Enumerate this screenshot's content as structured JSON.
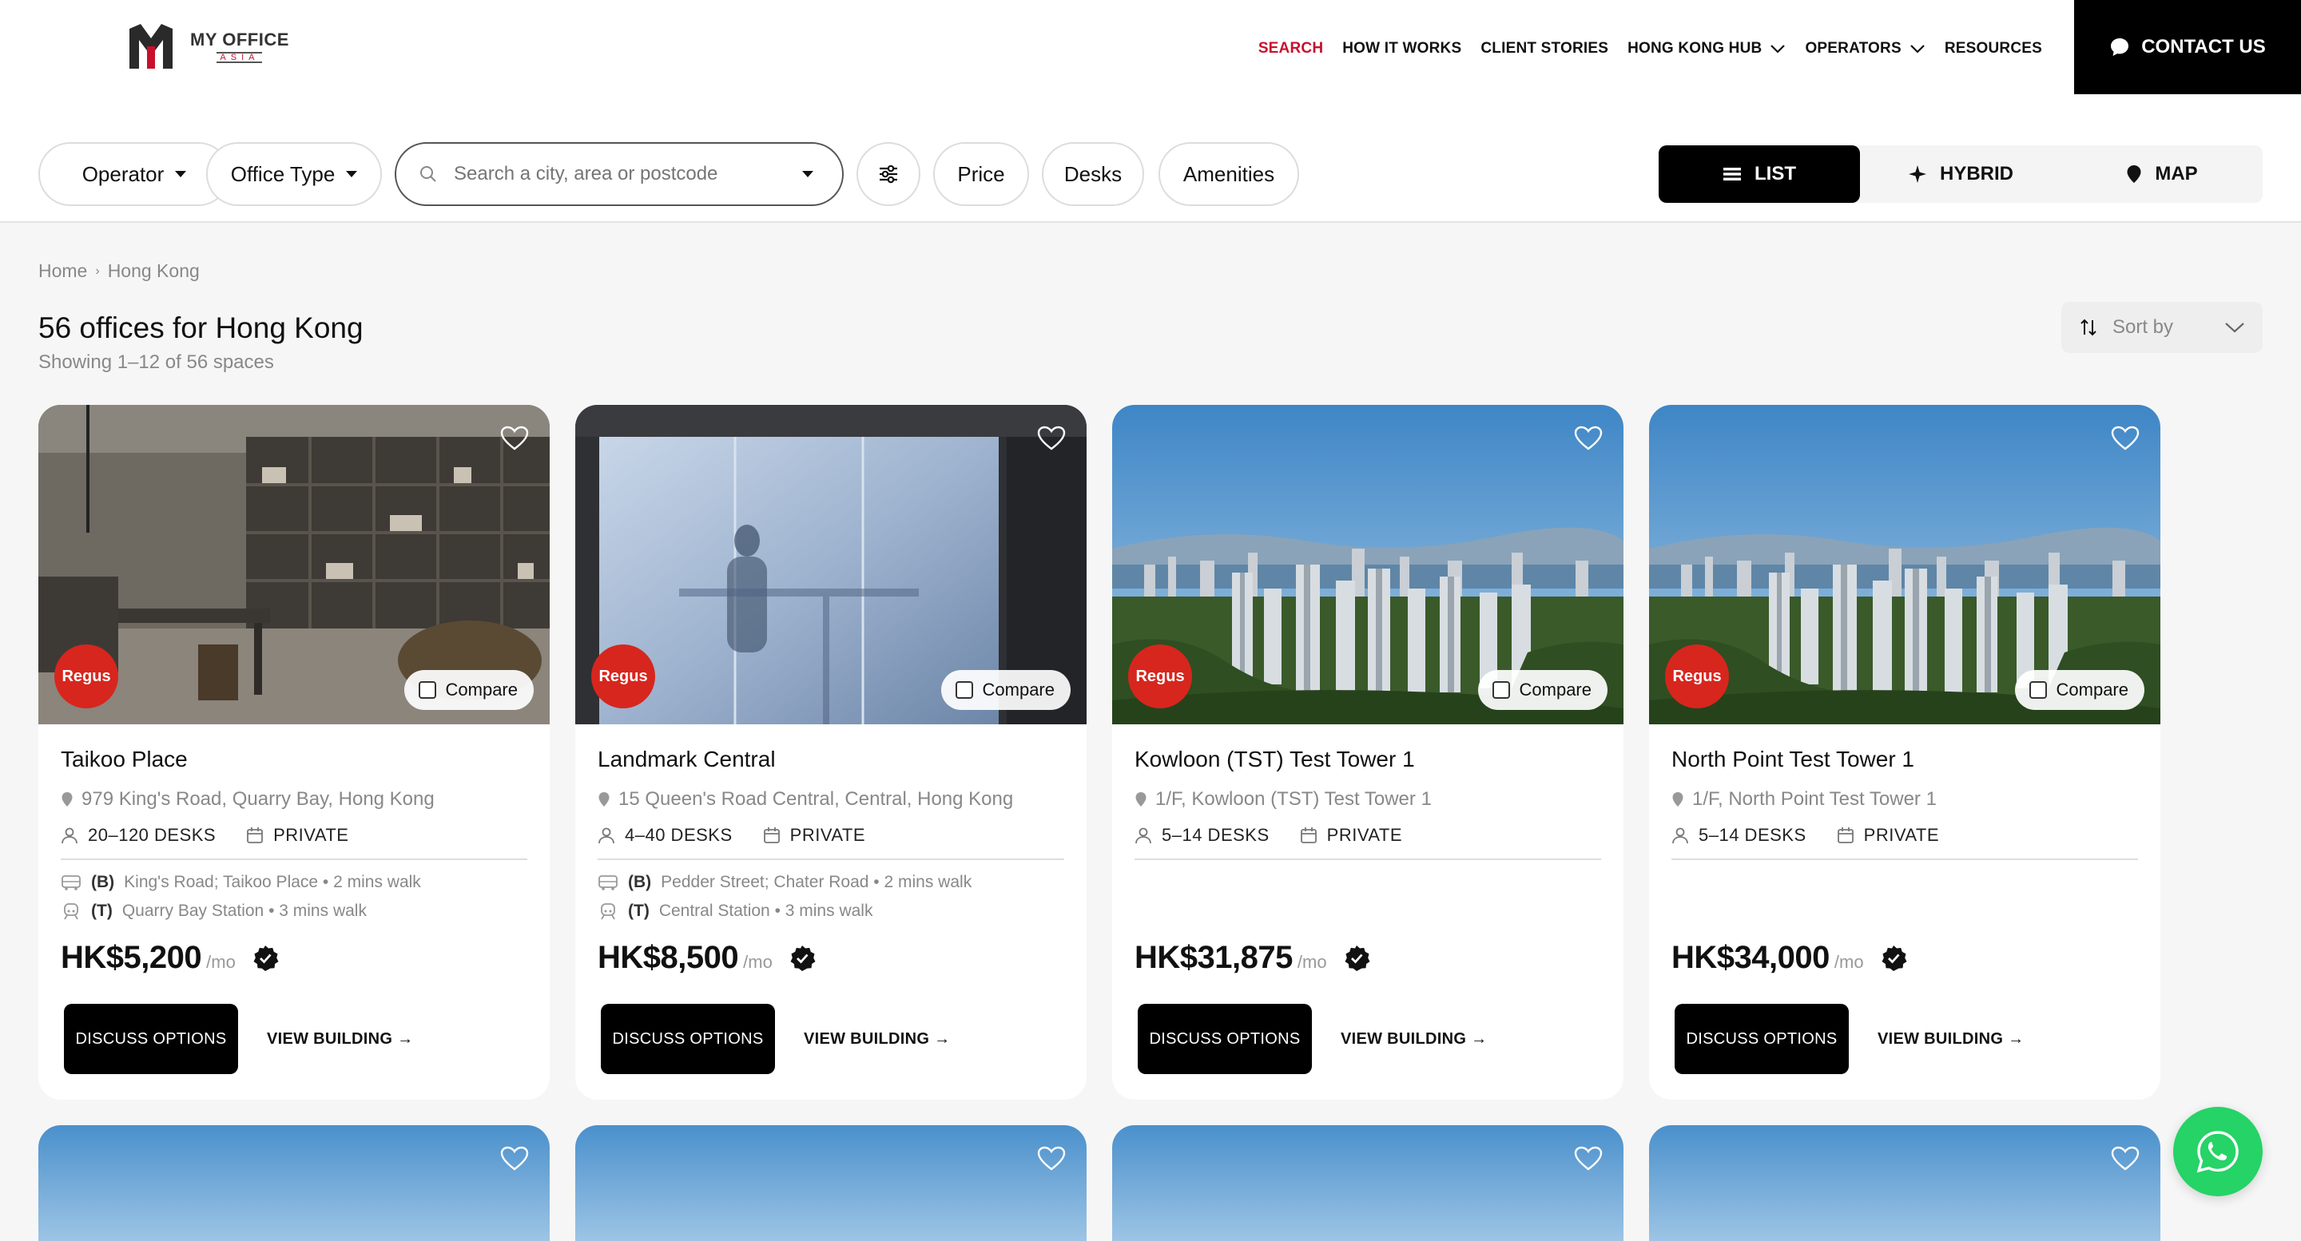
{
  "brand": {
    "name": "MY OFFICE",
    "tagline": "ASIA",
    "primary_color": "#c8102e"
  },
  "nav": {
    "items": [
      {
        "label": "SEARCH",
        "active": true
      },
      {
        "label": "HOW IT WORKS"
      },
      {
        "label": "CLIENT STORIES"
      },
      {
        "label": "HONG KONG HUB",
        "dropdown": true
      },
      {
        "label": "OPERATORS",
        "dropdown": true
      },
      {
        "label": "RESOURCES"
      }
    ],
    "contact_label": "CONTACT US"
  },
  "filters": {
    "operator": "Operator",
    "office_type": "Office Type",
    "search_placeholder": "Search a city, area or postcode",
    "price": "Price",
    "desks": "Desks",
    "amenities": "Amenities"
  },
  "view_toggle": {
    "list": "LIST",
    "hybrid": "HYBRID",
    "map": "MAP",
    "active": "list"
  },
  "breadcrumb": {
    "home": "Home",
    "current": "Hong Kong"
  },
  "results": {
    "title": "56 offices for Hong Kong",
    "subtitle": "Showing 1–12 of 56 spaces",
    "sort_label": "Sort by"
  },
  "card_labels": {
    "compare": "Compare",
    "discuss": "DISCUSS OPTIONS",
    "view": "VIEW BUILDING →",
    "per_month": "/mo",
    "brand_badge": "Regus"
  },
  "listings": [
    {
      "name": "Taikoo Place",
      "address": "979 King's Road, Quarry Bay, Hong Kong",
      "desks": "20–120 DESKS",
      "type": "PRIVATE",
      "bus_code": "(B)",
      "bus": "King's Road; Taikoo Place • 2 mins walk",
      "train_code": "(T)",
      "train": "Quarry Bay Station • 3 mins walk",
      "price": "HK$5,200",
      "image": "interior-office"
    },
    {
      "name": "Landmark Central",
      "address": "15 Queen's Road Central, Central, Hong Kong",
      "desks": "4–40 DESKS",
      "type": "PRIVATE",
      "bus_code": "(B)",
      "bus": "Pedder Street; Chater Road • 2 mins walk",
      "train_code": "(T)",
      "train": "Central Station • 3 mins walk",
      "price": "HK$8,500",
      "image": "frosted-glass"
    },
    {
      "name": "Kowloon (TST) Test Tower 1",
      "address": "1/F, Kowloon (TST) Test Tower 1",
      "desks": "5–14 DESKS",
      "type": "PRIVATE",
      "price": "HK$31,875",
      "image": "skyline"
    },
    {
      "name": "North Point Test Tower 1",
      "address": "1/F, North Point Test Tower 1",
      "desks": "5–14 DESKS",
      "type": "PRIVATE",
      "price": "HK$34,000",
      "image": "skyline"
    }
  ]
}
